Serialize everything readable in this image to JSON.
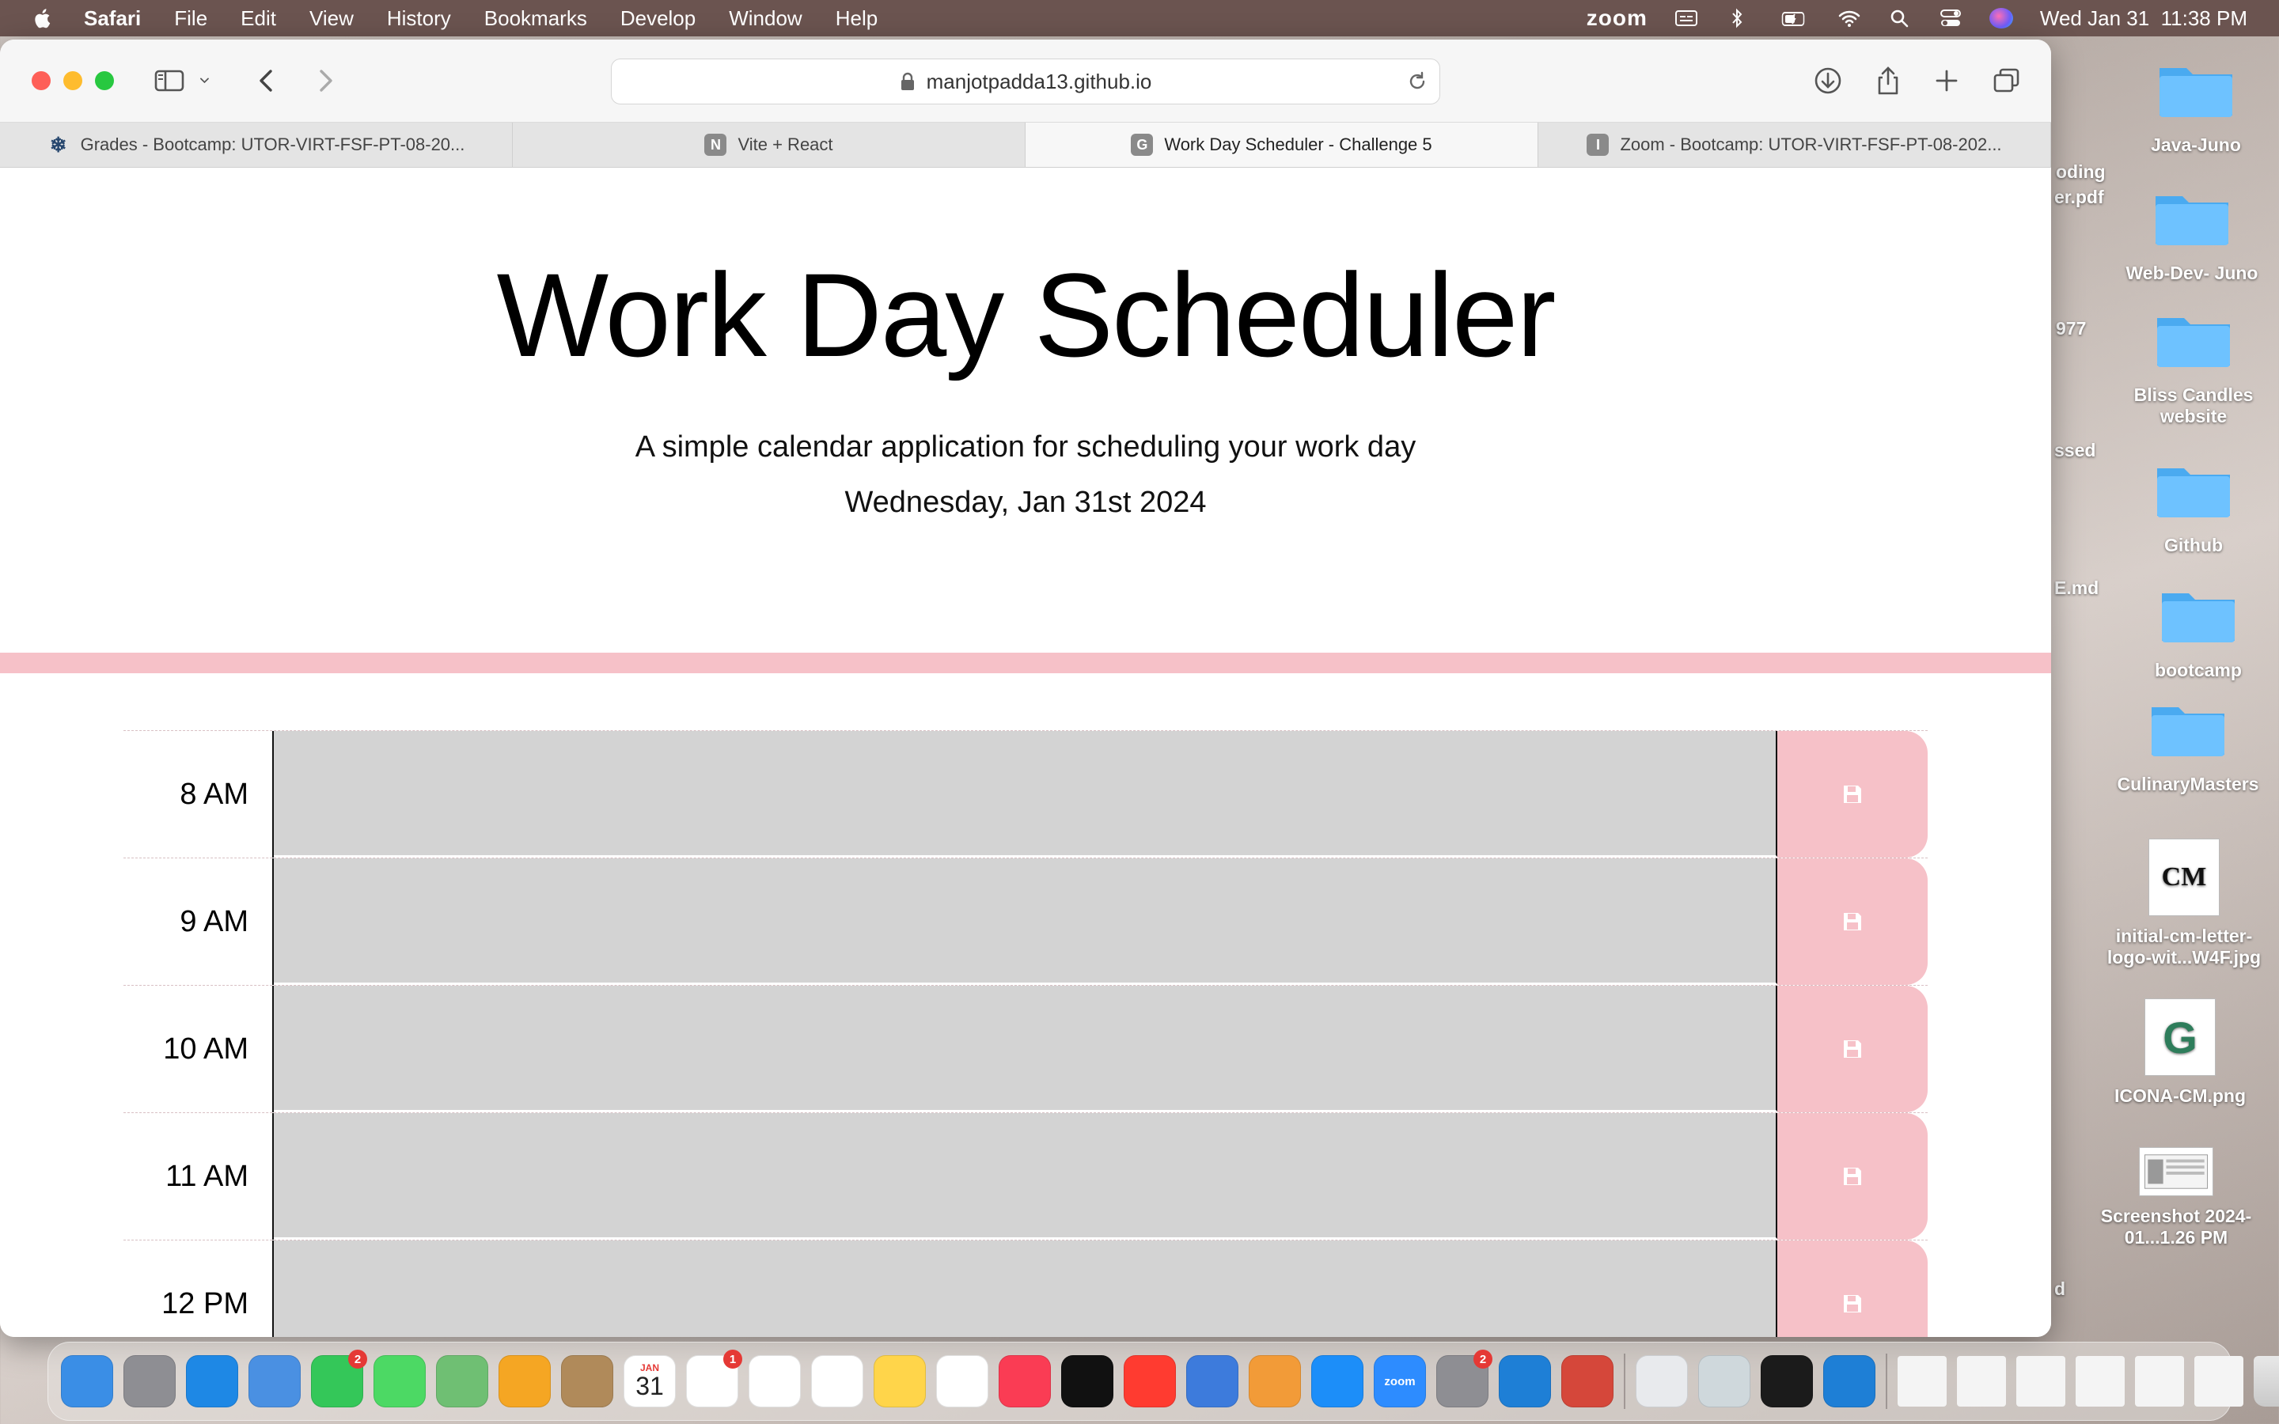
{
  "menubar": {
    "app": "Safari",
    "items": [
      "File",
      "Edit",
      "View",
      "History",
      "Bookmarks",
      "Develop",
      "Window",
      "Help"
    ],
    "zoom": "zoom",
    "datetime": "Wed Jan 31  11:38 PM"
  },
  "browser": {
    "url": "manjotpadda13.github.io",
    "tabs": [
      {
        "label": "Grades - Bootcamp: UTOR-VIRT-FSF-PT-08-20...",
        "favicon": "",
        "active": false
      },
      {
        "label": "Vite + React",
        "favicon": "N",
        "active": false
      },
      {
        "label": "Work Day Scheduler - Challenge 5",
        "favicon": "G",
        "active": true
      },
      {
        "label": "Zoom - Bootcamp: UTOR-VIRT-FSF-PT-08-202...",
        "favicon": "I",
        "active": false
      }
    ]
  },
  "page": {
    "title": "Work Day Scheduler",
    "lead": "A simple calendar application for scheduling your work day",
    "current_day": "Wednesday, Jan 31st 2024",
    "hours": [
      {
        "label": "8 AM",
        "text": ""
      },
      {
        "label": "9 AM",
        "text": ""
      },
      {
        "label": "10 AM",
        "text": ""
      },
      {
        "label": "11 AM",
        "text": ""
      },
      {
        "label": "12 PM",
        "text": ""
      }
    ]
  },
  "desktop": {
    "items": [
      {
        "label": "Java-Juno",
        "kind": "folder"
      },
      {
        "label": "Web-Dev- Juno",
        "kind": "folder"
      },
      {
        "label": "Bliss Candles website",
        "kind": "folder"
      },
      {
        "label": "Github",
        "kind": "folder"
      },
      {
        "label": "bootcamp",
        "kind": "folder"
      },
      {
        "label": "CulinaryMasters",
        "kind": "folder"
      },
      {
        "label": "initial-cm-letter-logo-wit...W4F.jpg",
        "kind": "image",
        "thumb_text": "CM"
      },
      {
        "label": "ICONA-CM.png",
        "kind": "image",
        "thumb_text": "G"
      },
      {
        "label": "Screenshot 2024-01...1.26 PM",
        "kind": "image",
        "thumb_text": ""
      }
    ],
    "partial_labels": [
      "oding",
      "er.pdf",
      "977",
      "ssed",
      "E.md",
      "d"
    ]
  },
  "dock": {
    "apps": [
      {
        "name": "finder-icon",
        "color": "#3a8ee6",
        "badge": ""
      },
      {
        "name": "launchpad-icon",
        "color": "#8e8e93",
        "badge": ""
      },
      {
        "name": "safari-icon",
        "color": "#1e88e5",
        "badge": ""
      },
      {
        "name": "mail-icon",
        "color": "#4a90e2",
        "badge": ""
      },
      {
        "name": "facetime-icon",
        "color": "#34c759",
        "badge": "2"
      },
      {
        "name": "messages-icon",
        "color": "#4cd964",
        "badge": ""
      },
      {
        "name": "maps-icon",
        "color": "#6fbf73",
        "badge": ""
      },
      {
        "name": "photos-icon",
        "color": "#f5a623",
        "badge": ""
      },
      {
        "name": "contacts-icon",
        "color": "#b08a5a",
        "badge": ""
      },
      {
        "name": "calendar-icon",
        "color": "#ffffff",
        "badge": ""
      },
      {
        "name": "slack-icon",
        "color": "#ffffff",
        "badge": "1"
      },
      {
        "name": "reminders-icon",
        "color": "#ffffff",
        "badge": ""
      },
      {
        "name": "numbers-icon",
        "color": "#ffffff",
        "badge": ""
      },
      {
        "name": "notes-icon",
        "color": "#ffd54a",
        "badge": ""
      },
      {
        "name": "freeform-icon",
        "color": "#ffffff",
        "badge": ""
      },
      {
        "name": "music-icon",
        "color": "#fa3c54",
        "badge": ""
      },
      {
        "name": "appletv-icon",
        "color": "#111111",
        "badge": ""
      },
      {
        "name": "news-icon",
        "color": "#ff3b30",
        "badge": ""
      },
      {
        "name": "keynote-icon",
        "color": "#3d7bdc",
        "badge": ""
      },
      {
        "name": "pages-icon",
        "color": "#f29b38",
        "badge": ""
      },
      {
        "name": "appstore-icon",
        "color": "#1c8ef9",
        "badge": ""
      },
      {
        "name": "zoom-icon",
        "color": "#2d8cff",
        "badge": ""
      },
      {
        "name": "settings-icon",
        "color": "#8e8e93",
        "badge": "2"
      },
      {
        "name": "vscode-icon",
        "color": "#1e7fd6",
        "badge": ""
      },
      {
        "name": "remote-desktop-icon",
        "color": "#d5473a",
        "badge": ""
      },
      {
        "name": "chrome-icon",
        "color": "#e8eaed",
        "badge": ""
      },
      {
        "name": "preview-icon",
        "color": "#cfd8dc",
        "badge": ""
      },
      {
        "name": "terminal-icon",
        "color": "#1b1b1b",
        "badge": ""
      },
      {
        "name": "vscode-insiders-icon",
        "color": "#1e7fd6",
        "badge": ""
      }
    ],
    "calendar": {
      "month": "JAN",
      "day": "31"
    },
    "zoom_label": "zoom"
  }
}
